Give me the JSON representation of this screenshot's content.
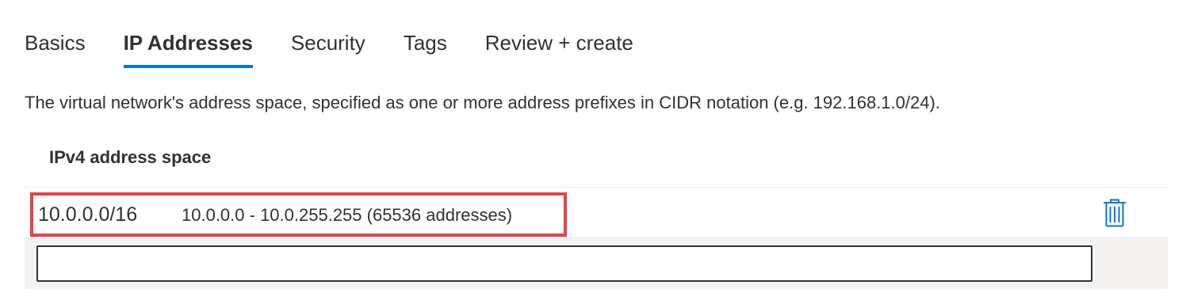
{
  "tabs": [
    {
      "label": "Basics",
      "active": false
    },
    {
      "label": "IP Addresses",
      "active": true
    },
    {
      "label": "Security",
      "active": false
    },
    {
      "label": "Tags",
      "active": false
    },
    {
      "label": "Review + create",
      "active": false
    }
  ],
  "description": "The virtual network's address space, specified as one or more address prefixes in CIDR notation (e.g. 192.168.1.0/24).",
  "address_space": {
    "header": "IPv4 address space",
    "entries": [
      {
        "cidr": "10.0.0.0/16",
        "range": "10.0.0.0 - 10.0.255.255 (65536 addresses)",
        "delete_icon": "trash-icon"
      }
    ],
    "new_entry": {
      "value": "",
      "placeholder": ""
    }
  },
  "colors": {
    "accent": "#0078d4",
    "highlight": "#e8414b",
    "row_background": "#f3f2f1",
    "text": "#323130"
  }
}
